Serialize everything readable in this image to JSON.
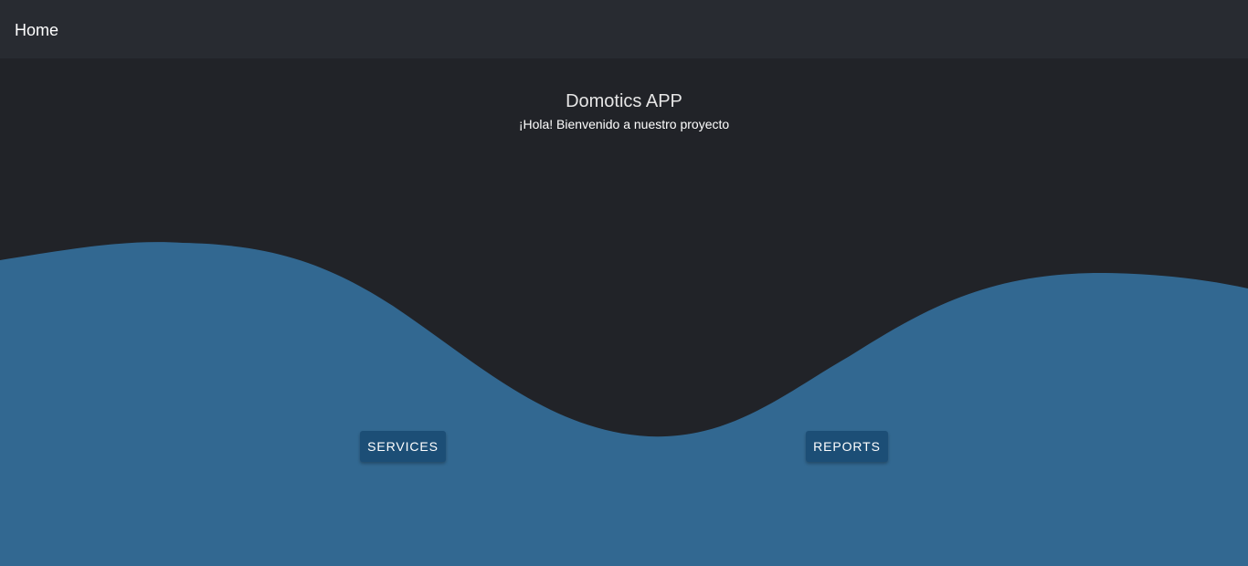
{
  "header": {
    "title": "Home"
  },
  "hero": {
    "title": "Domotics APP",
    "subtitle": "¡Hola! Bienvenido a nuestro proyecto"
  },
  "actions": {
    "services_label": "SERVICES",
    "reports_label": "REPORTS"
  },
  "colors": {
    "background": "#212328",
    "header_background": "#282b31",
    "wave": "#326891",
    "button": "#1c4e76",
    "text": "#ffffff"
  }
}
